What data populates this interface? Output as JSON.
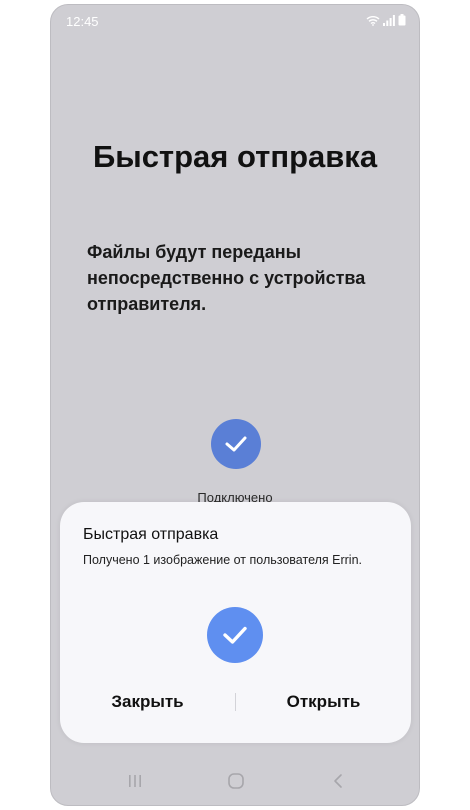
{
  "status_bar": {
    "time": "12:45",
    "icons": [
      "wifi-icon",
      "signal-icon",
      "battery-icon"
    ]
  },
  "background": {
    "title": "Быстрая отправка",
    "description": "Файлы будут переданы непосредственно с устройства отправителя.",
    "status": "Подключено"
  },
  "dialog": {
    "title": "Быстрая отправка",
    "message": "Получено 1 изображение от пользователя Errin.",
    "close_label": "Закрыть",
    "open_label": "Открыть"
  },
  "navigation": {
    "buttons": [
      "recent-apps-icon",
      "home-icon",
      "back-icon"
    ]
  },
  "colors": {
    "background": "#cfced3",
    "accent": "#5f8ff0",
    "dialog": "#f7f7fa"
  }
}
